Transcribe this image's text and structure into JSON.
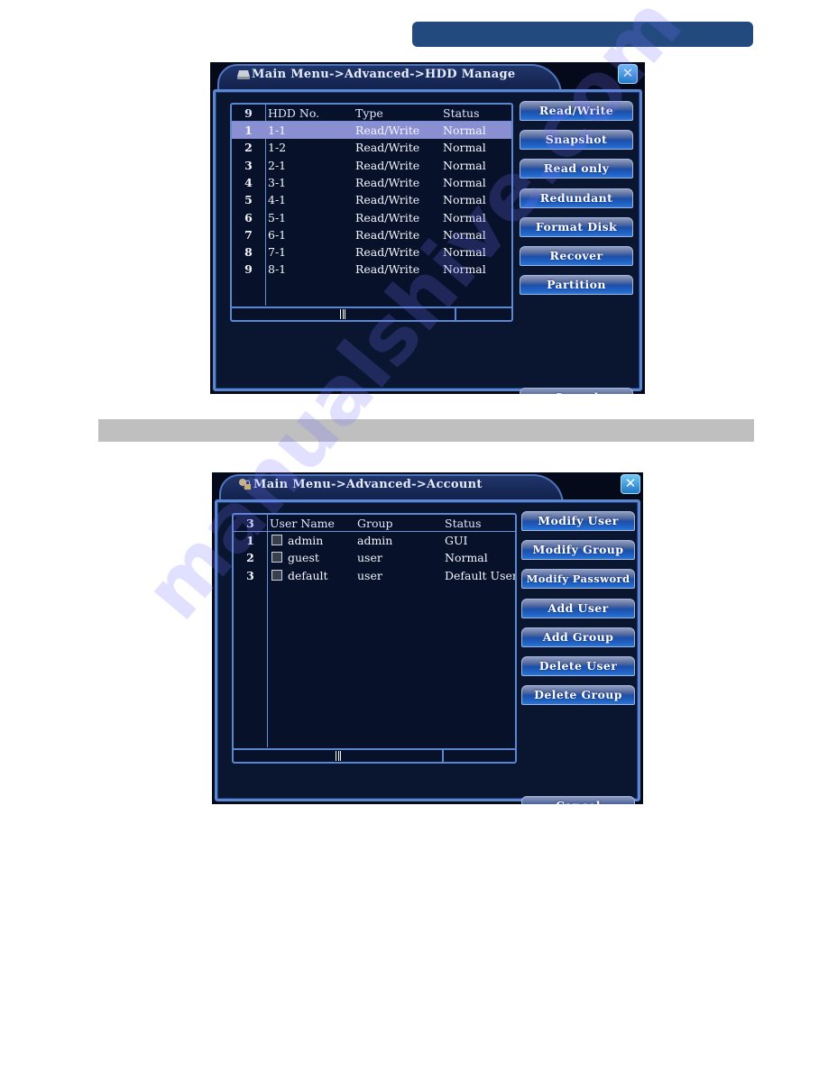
{
  "page": {
    "top_bar_color": "#224a7e",
    "section_bar_color": "#bfbfbf",
    "watermark": "manualshive.com"
  },
  "hdd_window": {
    "title": "Main Menu->Advanced->HDD Manage",
    "title_icon": "hdd-icon",
    "close_icon": "close-icon",
    "table": {
      "count": "9",
      "columns": [
        "HDD No.",
        "Type",
        "Status"
      ],
      "selected_index": 0,
      "rows": [
        {
          "num": "1",
          "hdd_no": "1-1",
          "type": "Read/Write",
          "status": "Normal"
        },
        {
          "num": "2",
          "hdd_no": "1-2",
          "type": "Read/Write",
          "status": "Normal"
        },
        {
          "num": "3",
          "hdd_no": "2-1",
          "type": "Read/Write",
          "status": "Normal"
        },
        {
          "num": "4",
          "hdd_no": "3-1",
          "type": "Read/Write",
          "status": "Normal"
        },
        {
          "num": "5",
          "hdd_no": "4-1",
          "type": "Read/Write",
          "status": "Normal"
        },
        {
          "num": "6",
          "hdd_no": "5-1",
          "type": "Read/Write",
          "status": "Normal"
        },
        {
          "num": "7",
          "hdd_no": "6-1",
          "type": "Read/Write",
          "status": "Normal"
        },
        {
          "num": "8",
          "hdd_no": "7-1",
          "type": "Read/Write",
          "status": "Normal"
        },
        {
          "num": "9",
          "hdd_no": "8-1",
          "type": "Read/Write",
          "status": "Normal"
        }
      ]
    },
    "buttons": [
      "Read/Write",
      "Snapshot",
      "Read only",
      "Redundant",
      "Format Disk",
      "Recover",
      "Partition"
    ],
    "cancel_label": "Cancel"
  },
  "account_window": {
    "title": "Main Menu->Advanced->Account",
    "title_icon": "user-lock-icon",
    "close_icon": "close-icon",
    "table": {
      "count": "3",
      "columns": [
        "User Name",
        "Group",
        "Status"
      ],
      "rows": [
        {
          "num": "1",
          "user": "admin",
          "group": "admin",
          "status": "GUI",
          "checked": false
        },
        {
          "num": "2",
          "user": "guest",
          "group": "user",
          "status": "Normal",
          "checked": false
        },
        {
          "num": "3",
          "user": "default",
          "group": "user",
          "status": "Default User",
          "checked": false
        }
      ]
    },
    "buttons": [
      "Modify User",
      "Modify Group",
      "Modify Password",
      "Add User",
      "Add Group",
      "Delete User",
      "Delete Group"
    ],
    "cancel_label": "Cancel"
  }
}
